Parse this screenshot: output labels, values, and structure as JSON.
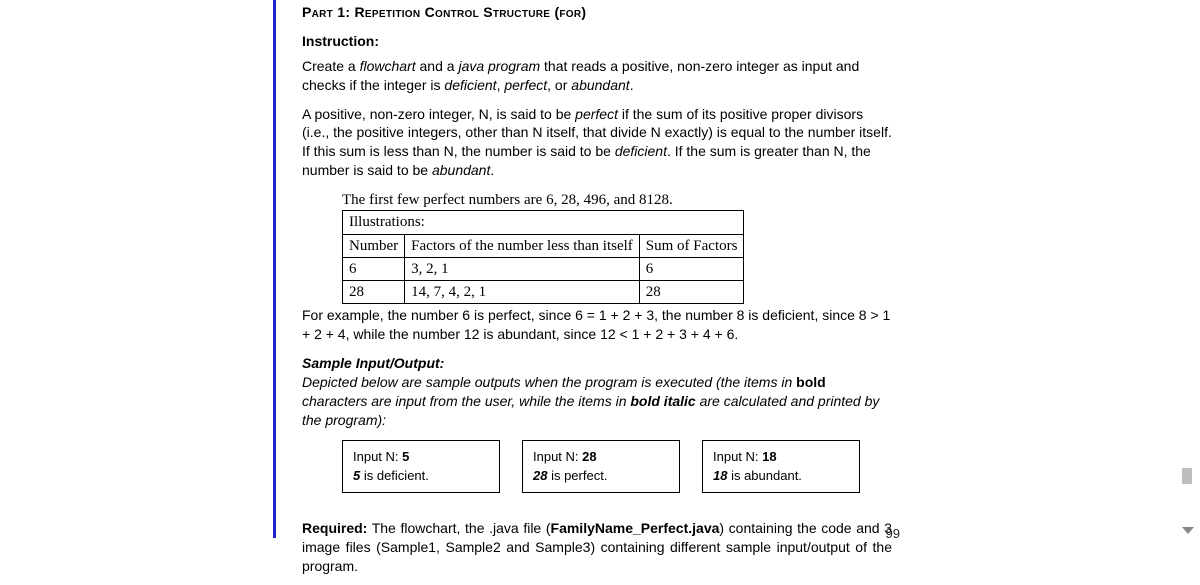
{
  "heading": "Part 1: Repetition Control Structure (for)",
  "instruction_label": "Instruction:",
  "p1_a": "Create a ",
  "p1_flow": "flowchart",
  "p1_b": " and a ",
  "p1_java": "java program",
  "p1_c": " that reads a positive, non-zero integer as input and checks if the integer is ",
  "p1_d": "deficient",
  "p1_e": ", ",
  "p1_f": "perfect",
  "p1_g": ", or ",
  "p1_h": "abundant",
  "p1_i": ".",
  "p2_a": "A positive, non-zero integer, N, is said to be ",
  "p2_perfect": "perfect",
  "p2_b": " if the sum of its positive proper divisors (i.e., the positive integers, other than N itself, that divide N exactly) is equal to the number itself.  If this sum is less than N, the number is said to be ",
  "p2_def": "deficient",
  "p2_c": ".  If the sum is greater than N, the number is said to be ",
  "p2_ab": "abundant",
  "p2_d": ".",
  "perfect_line": "The first few perfect numbers are 6, 28, 496, and 8128.",
  "table": {
    "caption": "Illustrations:",
    "h1": "Number",
    "h2": "Factors of the number less than itself",
    "h3": "Sum of Factors",
    "rows": [
      {
        "n": "6",
        "f": "3, 2, 1",
        "s": "6"
      },
      {
        "n": "28",
        "f": "14, 7, 4, 2, 1",
        "s": "28"
      }
    ]
  },
  "example_line": "For example, the number 6 is perfect, since 6 = 1 + 2 + 3, the number 8 is deficient, since 8 > 1 + 2 + 4, while the number 12 is abundant, since 12 < 1 + 2 + 3 + 4 + 6.",
  "sample_label": "Sample Input/Output:",
  "sample_desc_a": "Depicted below are sample outputs when the program is executed (the items in ",
  "sample_bold": "bold",
  "sample_desc_b": " characters are input from the user, while the items in ",
  "sample_bi": "bold italic",
  "sample_desc_c": " are calculated and printed by the program):",
  "samples": [
    {
      "prompt": "Input N:  ",
      "in": "5",
      "out_n": "5",
      "out_t": " is deficient."
    },
    {
      "prompt": "Input N:  ",
      "in": "28",
      "out_n": "28",
      "out_t": " is perfect."
    },
    {
      "prompt": "Input N:  ",
      "in": "18",
      "out_n": "18",
      "out_t": " is abundant."
    }
  ],
  "req_label": "Required:",
  "req_a": " The flowchart, the .java file (",
  "req_file": "FamilyName_Perfect.java",
  "req_b": ") containing the code and 3 image files (Sample1, Sample2 and Sample3) containing different sample input/output of the program.",
  "page_number": "99"
}
